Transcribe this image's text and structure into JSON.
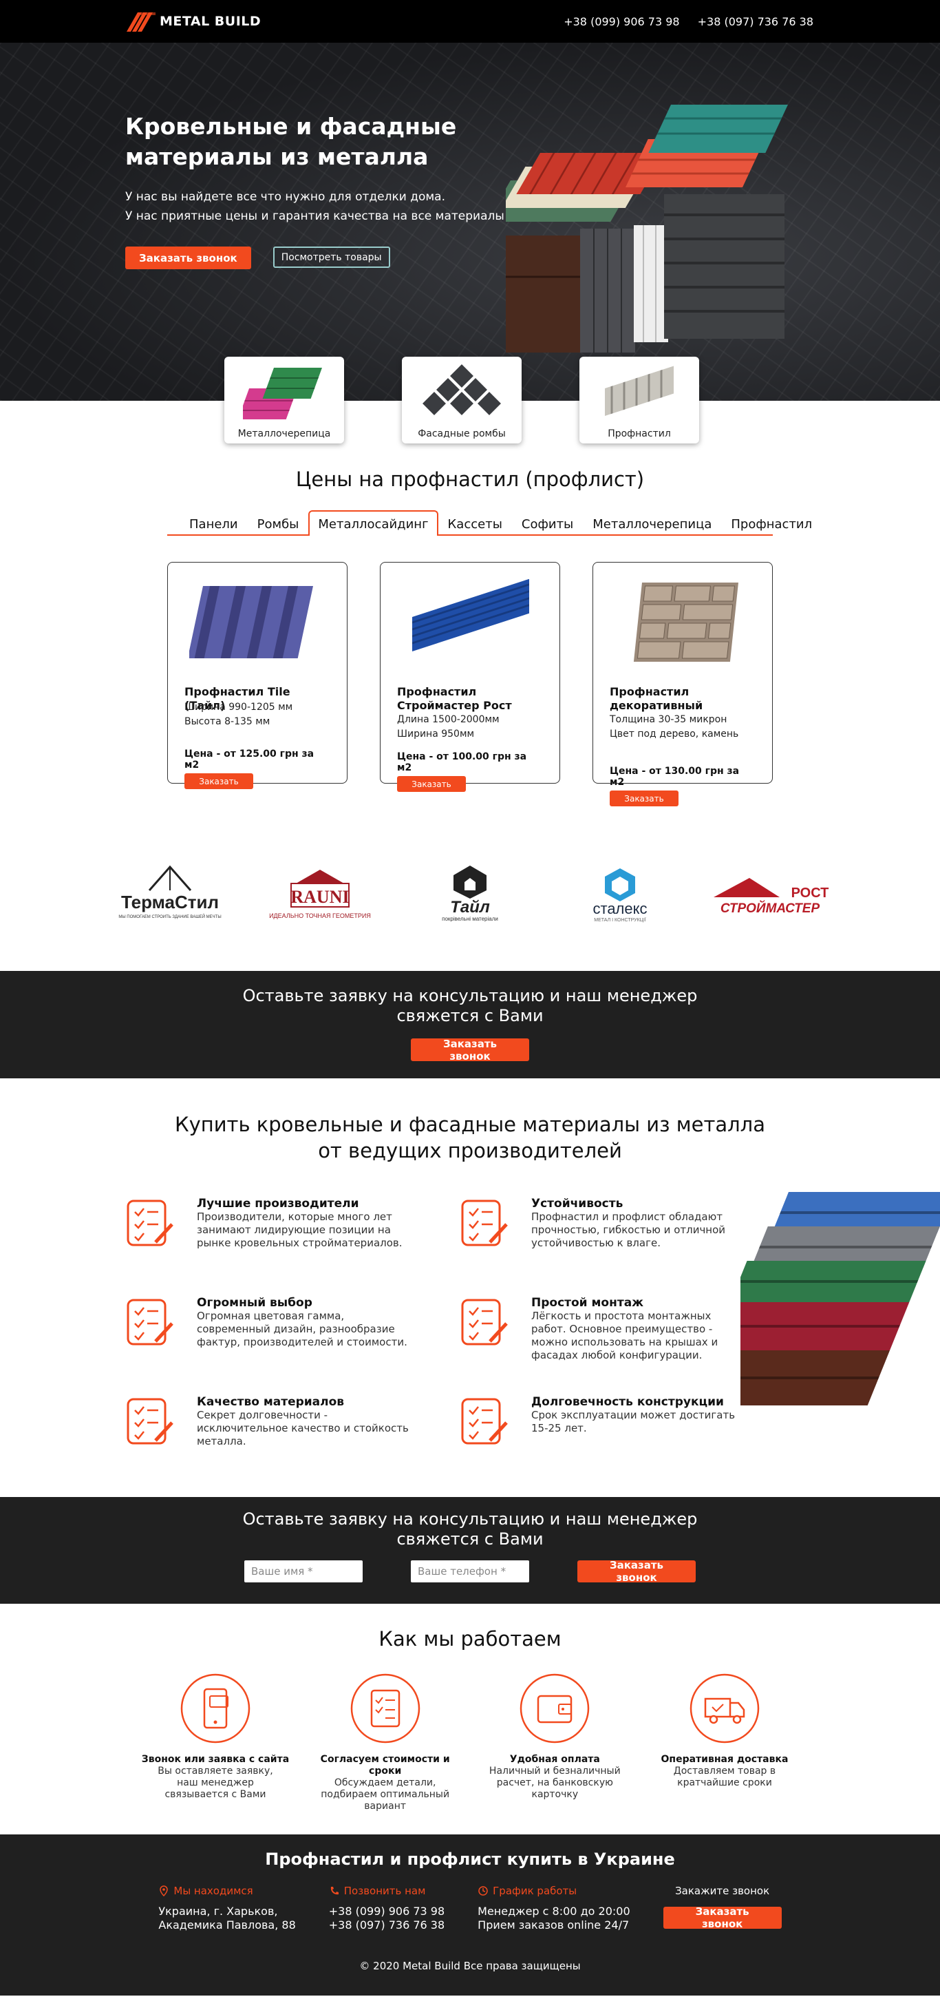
{
  "header": {
    "logo_text": "METAL BUILD",
    "phone1": "+38 (099) 906 73 98",
    "phone2": "+38 (097) 736 76 38"
  },
  "hero": {
    "title_line1": "Кровельные и фасадные",
    "title_line2": "материалы из металла",
    "sub_line1": "У нас вы найдете все что нужно для отделки дома.",
    "sub_line2": "У нас приятные цены и гарантия качества на все материалы",
    "btn_call": "Заказать звонок",
    "btn_products": "Посмотреть товары"
  },
  "categories": [
    {
      "label": "Металлочерепица"
    },
    {
      "label": "Фасадные ромбы"
    },
    {
      "label": "Профнастил"
    }
  ],
  "prices": {
    "title": "Цены на профнастил (профлист)",
    "tabs": [
      "Панели",
      "Ромбы",
      "Металлосайдинг",
      "Кассеты",
      "Софиты",
      "Металлочерепица",
      "Профнастил"
    ],
    "active_tab": "Металлосайдинг",
    "products": [
      {
        "name": "Профнастил Tile (Тайл)",
        "specs": [
          "Ширина 990-1205 мм",
          "Высота 8-135 мм"
        ],
        "price": "Цена - от 125.00 грн за м2",
        "btn": "Заказать"
      },
      {
        "name": "Профнастил Строймастер Рост",
        "specs": [
          "Длина 1500-2000мм",
          "Ширина 950мм"
        ],
        "price": "Цена - от 100.00 грн за м2",
        "btn": "Заказать"
      },
      {
        "name": "Профнастил декоративный",
        "specs": [
          "Толщина 30-35 микрон",
          "Цвет под дерево, камень"
        ],
        "price": "Цена - от 130.00 грн за м2",
        "btn": "Заказать"
      }
    ]
  },
  "brands": [
    {
      "name": "ТермаСтил",
      "tagline": "МЫ ПОМОГАЕМ СТРОИТЬ ЗДАНИЕ ВАШЕЙ МЕЧТЫ"
    },
    {
      "name": "RAUNI",
      "tagline": "ИДЕАЛЬНО ТОЧНАЯ ГЕОМЕТРИЯ"
    },
    {
      "name": "Тайл",
      "tagline": "покрівельні матеріали"
    },
    {
      "name": "сталекс",
      "tagline": "МЕТАЛ І КОНСТРУКЦІЇ"
    },
    {
      "name": "РОСТ",
      "name2": "СТРОЙМАСТЕР"
    }
  ],
  "cta1": {
    "line1": "Оставьте заявку на консультацию и наш менеджер",
    "line2": "свяжется с Вами",
    "btn": "Заказать звонок"
  },
  "features": {
    "title_line1": "Купить кровельные и фасадные материалы из металла",
    "title_line2": "от ведущих производителей",
    "items": [
      {
        "title": "Лучшие производители",
        "text": "Производители, которые много лет занимают лидирующие позиции на рынке кровельных стройматериалов."
      },
      {
        "title": "Устойчивость",
        "text": "Профнастил и профлист обладают прочностью, гибкостью и отличной устойчивостью к влаге."
      },
      {
        "title": "Огромный выбор",
        "text": "Огромная цветовая гамма, современный дизайн, разнообразие фактур, производителей и стоимости."
      },
      {
        "title": "Простой монтаж",
        "text": "Лёгкость и простота монтажных работ. Основное преимущество - можно использовать на крышах и фасадах любой конфигурации."
      },
      {
        "title": "Качество материалов",
        "text": "Секрет долговечности - исключительное качество и стойкость металла."
      },
      {
        "title": "Долговечность конструкции",
        "text": "Срок эксплуатации может достигать 15-25 лет."
      }
    ]
  },
  "cta2": {
    "line1": "Оставьте заявку на консультацию и наш менеджер",
    "line2": "свяжется с Вами",
    "name_placeholder": "Ваше имя *",
    "phone_placeholder": "Ваше телефон *",
    "btn": "Заказать звонок"
  },
  "how": {
    "title": "Как мы работаем",
    "steps": [
      {
        "title": "Звонок или заявка с сайта",
        "text": "Вы оставляете заявку, наш менеджер связывается с Вами",
        "icon": "phone-icon"
      },
      {
        "title": "Согласуем стоимости и сроки",
        "text": "Обсуждаем детали, подбираем оптимальный вариант",
        "icon": "checklist-icon"
      },
      {
        "title": "Удобная оплата",
        "text": "Наличный и безналичный расчет, на банковскую карточку",
        "icon": "wallet-icon"
      },
      {
        "title": "Оперативная доставка",
        "text": "Доставляем товар в кратчайшие сроки",
        "icon": "truck-icon"
      }
    ]
  },
  "footer": {
    "title": "Профнастил  и профлист купить в Украине",
    "location_head": "Мы находимся",
    "location_line1": "Украина, г. Харьков,",
    "location_line2": "Академика Павлова, 88",
    "call_head": "Позвонить нам",
    "call_line1": "+38 (099) 906 73 98",
    "call_line2": "+38 (097) 736 76 38",
    "hours_head": "График работы",
    "hours_line1": "Менеджер с 8:00 до 20:00",
    "hours_line2": "Прием заказов online 24/7",
    "order_head": "Закажите звонок",
    "order_btn": "Заказать звонок",
    "copyright": "© 2020 Metal Build Все права защищены"
  },
  "colors": {
    "accent": "#f24a1e",
    "dark": "#202020"
  }
}
